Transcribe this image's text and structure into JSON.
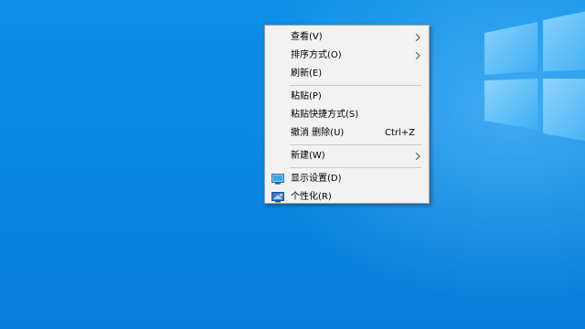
{
  "context_menu": {
    "items": [
      {
        "label": "查看(V)"
      },
      {
        "label": "排序方式(O)"
      },
      {
        "label": "刷新(E)"
      },
      {
        "label": "粘贴(P)"
      },
      {
        "label": "粘贴快捷方式(S)"
      },
      {
        "label": "撤消 删除(U)",
        "shortcut": "Ctrl+Z"
      },
      {
        "label": "新建(W)"
      },
      {
        "label": "显示设置(D)",
        "icon": "display-settings-icon"
      },
      {
        "label": "个性化(R)",
        "icon": "personalize-icon"
      }
    ]
  },
  "colors": {
    "desktop_blue": "#0a86e0",
    "menu_bg": "#f2f2f2",
    "separator": "#c8c8c8"
  }
}
